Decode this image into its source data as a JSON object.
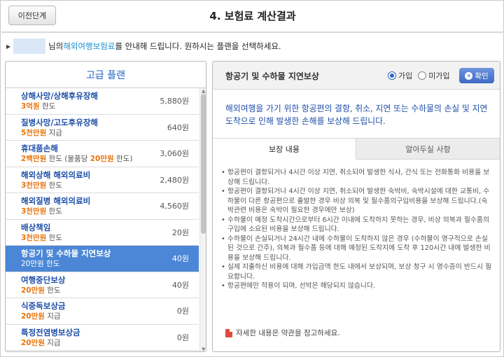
{
  "header": {
    "back_label": "이전단계",
    "title": "4. 보험료 계산결과"
  },
  "intro": {
    "suffix_name": "님의 ",
    "highlight": "해외여행보험료",
    "text": "를 안내해 드립니다.  원하시는 플랜을 선택하세요."
  },
  "plan_panel": {
    "title": "고급 플랜",
    "items": [
      {
        "name": "상해사망/상해후유장해",
        "amount": "3억원",
        "desc": " 한도",
        "price": "5,880원"
      },
      {
        "name": "질병사망/고도후유장해",
        "amount": "5천만원",
        "desc": " 지급",
        "price": "640원"
      },
      {
        "name": "휴대품손해",
        "amount": "2백만원",
        "desc": " 한도 (물품당 ",
        "amount2": "20만원",
        "desc2": " 한도)",
        "price": "3,060원"
      },
      {
        "name": "해외상해 해외의료비",
        "amount": "3천만원",
        "desc": " 한도",
        "price": "2,480원"
      },
      {
        "name": "해외질병 해외의료비",
        "amount": "3천만원",
        "desc": " 한도",
        "price": "4,560원"
      },
      {
        "name": "배상책임",
        "amount": "3천만원",
        "desc": " 한도",
        "price": "20원"
      },
      {
        "name": "항공기 및 수하물 지연보상",
        "amount": "20만원",
        "desc": " 한도",
        "price": "40원",
        "selected": true
      },
      {
        "name": "여행중단보상",
        "amount": "20만원",
        "desc": " 한도",
        "price": "40원"
      },
      {
        "name": "식중독보상금",
        "amount": "20만원",
        "desc": " 지급",
        "price": "0원"
      },
      {
        "name": "특정전염병보상금",
        "amount": "20만원",
        "desc": " 지급",
        "price": "0원"
      }
    ]
  },
  "detail_panel": {
    "title": "항공기 및 수하물 지연보상",
    "radio_join": "가입",
    "radio_nojoin": "미가입",
    "selected_radio": "가입",
    "confirm_label": "확인",
    "summary": "해외여행을 가기 위한 항공편의 결항, 취소, 지연 또는 수하물의 손실 및 지연도착으로 인해 발생한 손해를 보상해 드립니다.",
    "tabs": [
      "보장 내용",
      "알아두실 사항"
    ],
    "active_tab": "보장 내용",
    "details": [
      "항공편이 결항되거나 4시간 이상 지연, 취소되어 발생한 식사, 간식 또는 전화통화 비용을 보상해 드립니다.",
      "항공편이 결항되거나 4시간 이상 지연, 취소되어 발생한 숙박비, 숙박시설에 대한 교통비, 수하물이 다른 항공편으로 출발한 경우 비상 의복 및 필수품의구입비용을 보상해 드립니다.(숙박관련 비용은 숙박이 필요한 경우에만 보상)",
      "수하물이 예정 도착시간으로부터 6시간 이내에 도착하지 못하는 경우, 비상 의복과 필수품의 구입에 소요된 비용을 보상해 드립니다.",
      "수하물이 손실되거나 24시간 내에 수하물이 도착하지 않은 경우 (수하물이 영구적으로 손실된 것으로 간주), 의복과 필수품 등에 대해 예정된 도착지에 도착 후 120시간 내에 발생한 비용을 보상해 드립니다.",
      "실제 지출하신 비용에 대해 가입금액 한도 내에서 보상되며, 보상 청구 시 영수증이 반드시 필요합니다.",
      "항공편에만 적용이 되며, 선박은 해당되지 않습니다."
    ],
    "footnote": "자세한 내용은 약관을 참고하세요."
  }
}
